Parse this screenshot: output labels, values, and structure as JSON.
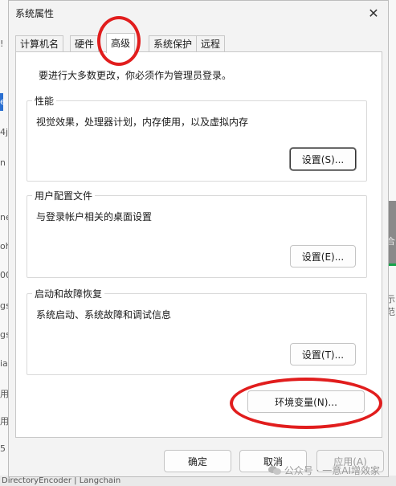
{
  "background": {
    "left_fragments": [
      "!",
      "e",
      "4j",
      "n ,",
      "ne",
      "oh",
      "00",
      "gs",
      "gs",
      "ia",
      "用",
      "用",
      "5",
      "DirectoryEncoder | Langchain"
    ],
    "right_fragments": [
      "合",
      "示范"
    ]
  },
  "dialog": {
    "title": "系统属性",
    "close_symbol": "✕",
    "tabs": [
      {
        "label": "计算机名",
        "active": false
      },
      {
        "label": "硬件",
        "active": false
      },
      {
        "label": "高级",
        "active": true
      },
      {
        "label": "系统保护",
        "active": false
      },
      {
        "label": "远程",
        "active": false
      }
    ],
    "admin_note": "要进行大多数更改，你必须作为管理员登录。",
    "groups": [
      {
        "title": "性能",
        "description": "视觉效果，处理器计划，内存使用，以及虚拟内存",
        "button": "设置(S)...",
        "focused": true
      },
      {
        "title": "用户配置文件",
        "description": "与登录帐户相关的桌面设置",
        "button": "设置(E)...",
        "focused": false
      },
      {
        "title": "启动和故障恢复",
        "description": "系统启动、系统故障和调试信息",
        "button": "设置(T)...",
        "focused": false
      }
    ],
    "env_button": "环境变量(N)...",
    "footer": {
      "ok": "确定",
      "cancel": "取消",
      "apply": "应用(A)"
    }
  },
  "watermark": {
    "text": "公众号 · 一意AI增效家"
  },
  "colors": {
    "annotation_red": "#e11d1d",
    "panel_bg": "#ffffff",
    "dialog_bg": "#f3f3f3"
  }
}
